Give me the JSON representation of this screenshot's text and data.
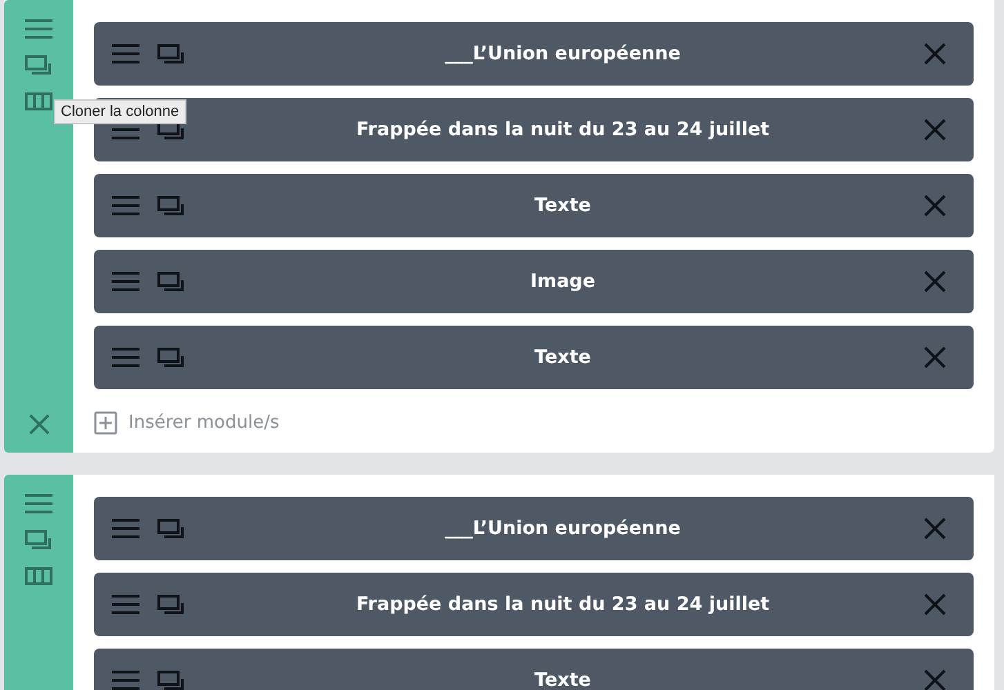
{
  "sections": [
    {
      "tooltip": "Cloner la colonne",
      "insert_label": "Insérer module/s",
      "modules": [
        {
          "title": "___L’Union européenne"
        },
        {
          "title": "Frappée dans la nuit du 23 au 24 juillet"
        },
        {
          "title": "Texte"
        },
        {
          "title": "Image"
        },
        {
          "title": "Texte"
        }
      ]
    },
    {
      "modules": [
        {
          "title": "___L’Union européenne"
        },
        {
          "title": "Frappée dans la nuit du 23 au 24 juillet"
        },
        {
          "title": "Texte"
        }
      ]
    }
  ]
}
